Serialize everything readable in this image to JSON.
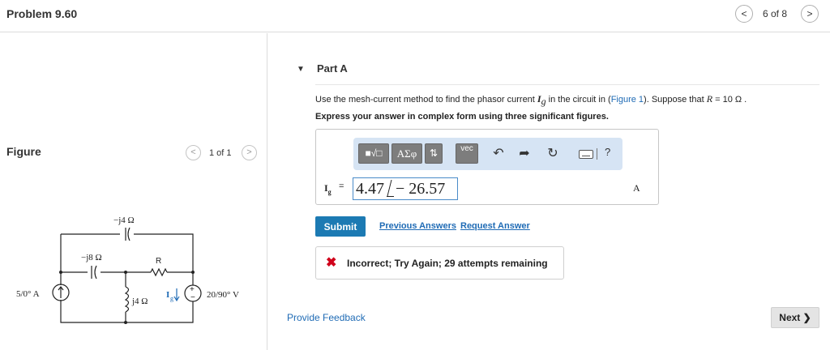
{
  "header": {
    "title": "Problem 9.60",
    "pager_text": "6 of 8",
    "prev_glyph": "<",
    "next_glyph": ">"
  },
  "figure_panel": {
    "title": "Figure",
    "pager_text": "1 of 1",
    "prev_glyph": "<",
    "next_glyph": ">",
    "circuit_labels": {
      "top_capacitor": "−j4 Ω",
      "inner_capacitor": "−j8 Ω",
      "resistor": "R",
      "inductor": "j4 Ω",
      "current_source": "5/0° A",
      "current_label": "I",
      "current_sub": "g",
      "voltage_source": "20/90° V"
    }
  },
  "part": {
    "arrow_glyph": "▼",
    "title": "Part A",
    "question_pre": "Use the mesh-current method to find the phasor current ",
    "question_var": "I",
    "question_sub": "g",
    "question_mid": " in the circuit in (",
    "figure_link": "Figure 1",
    "question_post": "). Suppose that ",
    "r_var": "R",
    "r_value": " = 10  Ω .",
    "instruction": "Express your answer in complex form using three significant figures."
  },
  "toolbar": {
    "templates_label": "■√□",
    "greek_label": "AΣφ",
    "sort_label": "⇅",
    "vec_label": "vec",
    "undo_icon": "↶",
    "redo_icon": "➦",
    "reset_icon": "↻",
    "help_label": "?"
  },
  "answer": {
    "var": "I",
    "sub": "g",
    "equals": "=",
    "magnitude": "4.47",
    "angle": "− 26.57",
    "unit": "A"
  },
  "actions": {
    "submit_label": "Submit",
    "previous_answers": "Previous Answers",
    "request_answer": "Request Answer"
  },
  "feedback": {
    "icon": "✖",
    "text": "Incorrect; Try Again; 29 attempts remaining"
  },
  "footer": {
    "provide_feedback": "Provide Feedback",
    "next_label": "Next ❯"
  },
  "colors": {
    "accent": "#1c7ab3",
    "link": "#1f6bb5",
    "error": "#d0021b",
    "toolbar_bg": "#d6e4f4"
  }
}
